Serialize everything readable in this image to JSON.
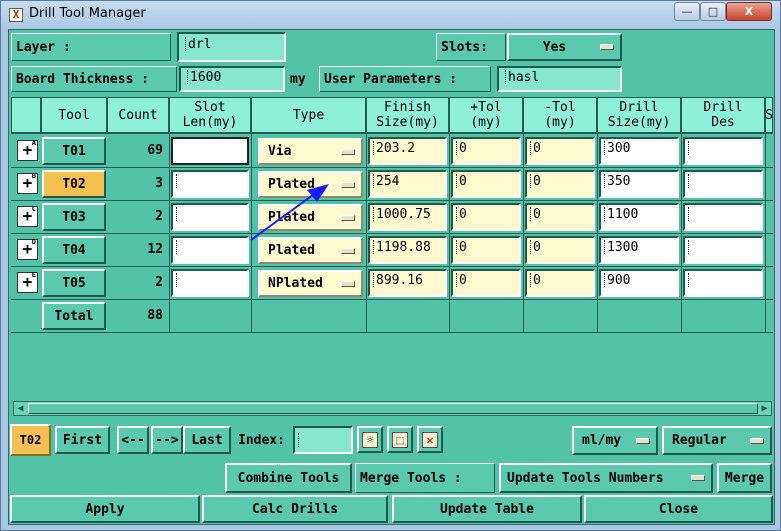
{
  "window": {
    "title": "Drill Tool Manager",
    "minimize": "—",
    "maximize": "□",
    "close": "X",
    "app_icon": "X"
  },
  "top": {
    "layer_label": "Layer         :",
    "layer_value": "drl",
    "slots_label": "Slots:",
    "slots_value": "Yes",
    "board_thickness_label": "Board Thickness :",
    "board_thickness_value": "1600",
    "unit": "my",
    "user_params_label": "User Parameters :",
    "user_params_value": "hasl"
  },
  "table": {
    "headers": [
      "Tool",
      "Count",
      "Slot\nLen(my)",
      "Type",
      "Finish\nSize(my)",
      "+Tol\n(my)",
      "-Tol\n(my)",
      "Drill\nSize(my)",
      "Drill\nDes",
      "S"
    ],
    "rows": [
      {
        "mark": "+",
        "idx": "A",
        "tool": "T01",
        "count": "69",
        "slot": "",
        "type": "Via",
        "finish": "203.2",
        "ptol": "0",
        "ntol": "0",
        "drill": "300",
        "des": ""
      },
      {
        "mark": "+",
        "idx": "B",
        "tool": "T02",
        "count": "3",
        "slot": "",
        "type": "Plated",
        "finish": "254",
        "ptol": "0",
        "ntol": "0",
        "drill": "350",
        "des": ""
      },
      {
        "mark": "+",
        "idx": "C",
        "tool": "T03",
        "count": "2",
        "slot": "",
        "type": "Plated",
        "finish": "1000.75",
        "ptol": "0",
        "ntol": "0",
        "drill": "1100",
        "des": ""
      },
      {
        "mark": "+",
        "idx": "D",
        "tool": "T04",
        "count": "12",
        "slot": "",
        "type": "Plated",
        "finish": "1198.88",
        "ptol": "0",
        "ntol": "0",
        "drill": "1300",
        "des": ""
      },
      {
        "mark": "+",
        "idx": "E",
        "tool": "T05",
        "count": "2",
        "slot": "",
        "type": "NPlated",
        "finish": "899.16",
        "ptol": "0",
        "ntol": "0",
        "drill": "900",
        "des": ""
      }
    ],
    "total_label": "Total",
    "total_count": "88",
    "scroll_left": "◀",
    "scroll_right": "▶"
  },
  "nav": {
    "current_tool": "T02",
    "first": "First",
    "prev": "<--",
    "next": "-->",
    "last": "Last",
    "index_label": "Index:",
    "index_value": "",
    "units_value": "ml/my",
    "mode_value": "Regular",
    "icon_bulb": "bulb-icon",
    "icon_select": "select-icon",
    "icon_delete": "delete-icon"
  },
  "tools": {
    "combine": "Combine Tools",
    "merge_label": "Merge Tools :",
    "merge_value": "Update Tools Numbers",
    "merge": "Merge"
  },
  "footer": {
    "apply": "Apply",
    "calc": "Calc Drills",
    "update": "Update Table",
    "close": "Close"
  }
}
